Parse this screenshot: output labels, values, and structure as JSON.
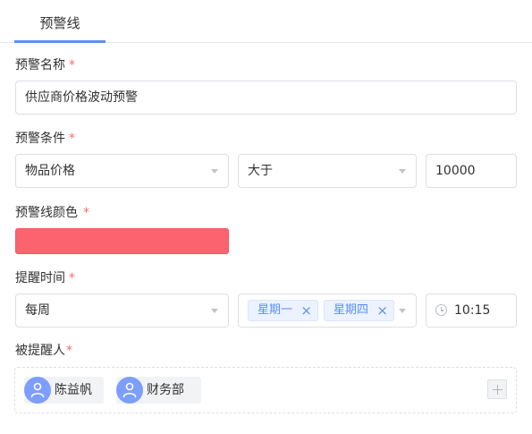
{
  "tabs": [
    {
      "label": "预警线",
      "active": true
    }
  ],
  "form": {
    "name": {
      "label": "预警名称",
      "required_mark": "*",
      "value": "供应商价格波动预警"
    },
    "condition": {
      "label": "预警条件",
      "required_mark": "*",
      "field": "物品价格",
      "operator": "大于",
      "threshold": "10000"
    },
    "color": {
      "label": "预警线颜色",
      "required_mark": "*",
      "value": "#fb646e"
    },
    "remind_time": {
      "label": "提醒时间",
      "required_mark": "*",
      "frequency": "每周",
      "days": [
        {
          "label": "星期一",
          "remove": "×"
        },
        {
          "label": "星期四",
          "remove": "×"
        }
      ],
      "time": "10:15"
    },
    "assignees": {
      "label": "被提醒人",
      "required_mark": "*",
      "people": [
        {
          "name": "陈益帆",
          "icon": "user-icon"
        },
        {
          "name": "财务部",
          "icon": "user-icon"
        }
      ],
      "add_icon": "plus-icon"
    }
  },
  "colors": {
    "accent": "#5b8ff9",
    "required": "#f56c6c",
    "avatar": "#7c9efc",
    "warning_line": "#fb646e"
  }
}
